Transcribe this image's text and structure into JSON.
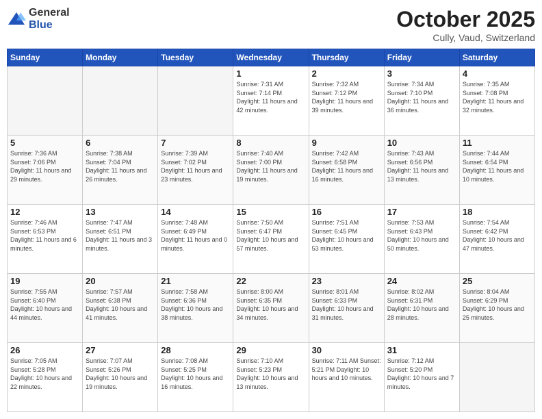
{
  "header": {
    "logo_general": "General",
    "logo_blue": "Blue",
    "title": "October 2025",
    "subtitle": "Cully, Vaud, Switzerland"
  },
  "days_of_week": [
    "Sunday",
    "Monday",
    "Tuesday",
    "Wednesday",
    "Thursday",
    "Friday",
    "Saturday"
  ],
  "weeks": [
    [
      {
        "day": "",
        "info": ""
      },
      {
        "day": "",
        "info": ""
      },
      {
        "day": "",
        "info": ""
      },
      {
        "day": "1",
        "info": "Sunrise: 7:31 AM\nSunset: 7:14 PM\nDaylight: 11 hours\nand 42 minutes."
      },
      {
        "day": "2",
        "info": "Sunrise: 7:32 AM\nSunset: 7:12 PM\nDaylight: 11 hours\nand 39 minutes."
      },
      {
        "day": "3",
        "info": "Sunrise: 7:34 AM\nSunset: 7:10 PM\nDaylight: 11 hours\nand 36 minutes."
      },
      {
        "day": "4",
        "info": "Sunrise: 7:35 AM\nSunset: 7:08 PM\nDaylight: 11 hours\nand 32 minutes."
      }
    ],
    [
      {
        "day": "5",
        "info": "Sunrise: 7:36 AM\nSunset: 7:06 PM\nDaylight: 11 hours\nand 29 minutes."
      },
      {
        "day": "6",
        "info": "Sunrise: 7:38 AM\nSunset: 7:04 PM\nDaylight: 11 hours\nand 26 minutes."
      },
      {
        "day": "7",
        "info": "Sunrise: 7:39 AM\nSunset: 7:02 PM\nDaylight: 11 hours\nand 23 minutes."
      },
      {
        "day": "8",
        "info": "Sunrise: 7:40 AM\nSunset: 7:00 PM\nDaylight: 11 hours\nand 19 minutes."
      },
      {
        "day": "9",
        "info": "Sunrise: 7:42 AM\nSunset: 6:58 PM\nDaylight: 11 hours\nand 16 minutes."
      },
      {
        "day": "10",
        "info": "Sunrise: 7:43 AM\nSunset: 6:56 PM\nDaylight: 11 hours\nand 13 minutes."
      },
      {
        "day": "11",
        "info": "Sunrise: 7:44 AM\nSunset: 6:54 PM\nDaylight: 11 hours\nand 10 minutes."
      }
    ],
    [
      {
        "day": "12",
        "info": "Sunrise: 7:46 AM\nSunset: 6:53 PM\nDaylight: 11 hours\nand 6 minutes."
      },
      {
        "day": "13",
        "info": "Sunrise: 7:47 AM\nSunset: 6:51 PM\nDaylight: 11 hours\nand 3 minutes."
      },
      {
        "day": "14",
        "info": "Sunrise: 7:48 AM\nSunset: 6:49 PM\nDaylight: 11 hours\nand 0 minutes."
      },
      {
        "day": "15",
        "info": "Sunrise: 7:50 AM\nSunset: 6:47 PM\nDaylight: 10 hours\nand 57 minutes."
      },
      {
        "day": "16",
        "info": "Sunrise: 7:51 AM\nSunset: 6:45 PM\nDaylight: 10 hours\nand 53 minutes."
      },
      {
        "day": "17",
        "info": "Sunrise: 7:53 AM\nSunset: 6:43 PM\nDaylight: 10 hours\nand 50 minutes."
      },
      {
        "day": "18",
        "info": "Sunrise: 7:54 AM\nSunset: 6:42 PM\nDaylight: 10 hours\nand 47 minutes."
      }
    ],
    [
      {
        "day": "19",
        "info": "Sunrise: 7:55 AM\nSunset: 6:40 PM\nDaylight: 10 hours\nand 44 minutes."
      },
      {
        "day": "20",
        "info": "Sunrise: 7:57 AM\nSunset: 6:38 PM\nDaylight: 10 hours\nand 41 minutes."
      },
      {
        "day": "21",
        "info": "Sunrise: 7:58 AM\nSunset: 6:36 PM\nDaylight: 10 hours\nand 38 minutes."
      },
      {
        "day": "22",
        "info": "Sunrise: 8:00 AM\nSunset: 6:35 PM\nDaylight: 10 hours\nand 34 minutes."
      },
      {
        "day": "23",
        "info": "Sunrise: 8:01 AM\nSunset: 6:33 PM\nDaylight: 10 hours\nand 31 minutes."
      },
      {
        "day": "24",
        "info": "Sunrise: 8:02 AM\nSunset: 6:31 PM\nDaylight: 10 hours\nand 28 minutes."
      },
      {
        "day": "25",
        "info": "Sunrise: 8:04 AM\nSunset: 6:29 PM\nDaylight: 10 hours\nand 25 minutes."
      }
    ],
    [
      {
        "day": "26",
        "info": "Sunrise: 7:05 AM\nSunset: 5:28 PM\nDaylight: 10 hours\nand 22 minutes."
      },
      {
        "day": "27",
        "info": "Sunrise: 7:07 AM\nSunset: 5:26 PM\nDaylight: 10 hours\nand 19 minutes."
      },
      {
        "day": "28",
        "info": "Sunrise: 7:08 AM\nSunset: 5:25 PM\nDaylight: 10 hours\nand 16 minutes."
      },
      {
        "day": "29",
        "info": "Sunrise: 7:10 AM\nSunset: 5:23 PM\nDaylight: 10 hours\nand 13 minutes."
      },
      {
        "day": "30",
        "info": "Sunrise: 7:11 AM\nSunset: 5:21 PM\nDaylight: 10 hours\nand 10 minutes."
      },
      {
        "day": "31",
        "info": "Sunrise: 7:12 AM\nSunset: 5:20 PM\nDaylight: 10 hours\nand 7 minutes."
      },
      {
        "day": "",
        "info": ""
      }
    ]
  ]
}
